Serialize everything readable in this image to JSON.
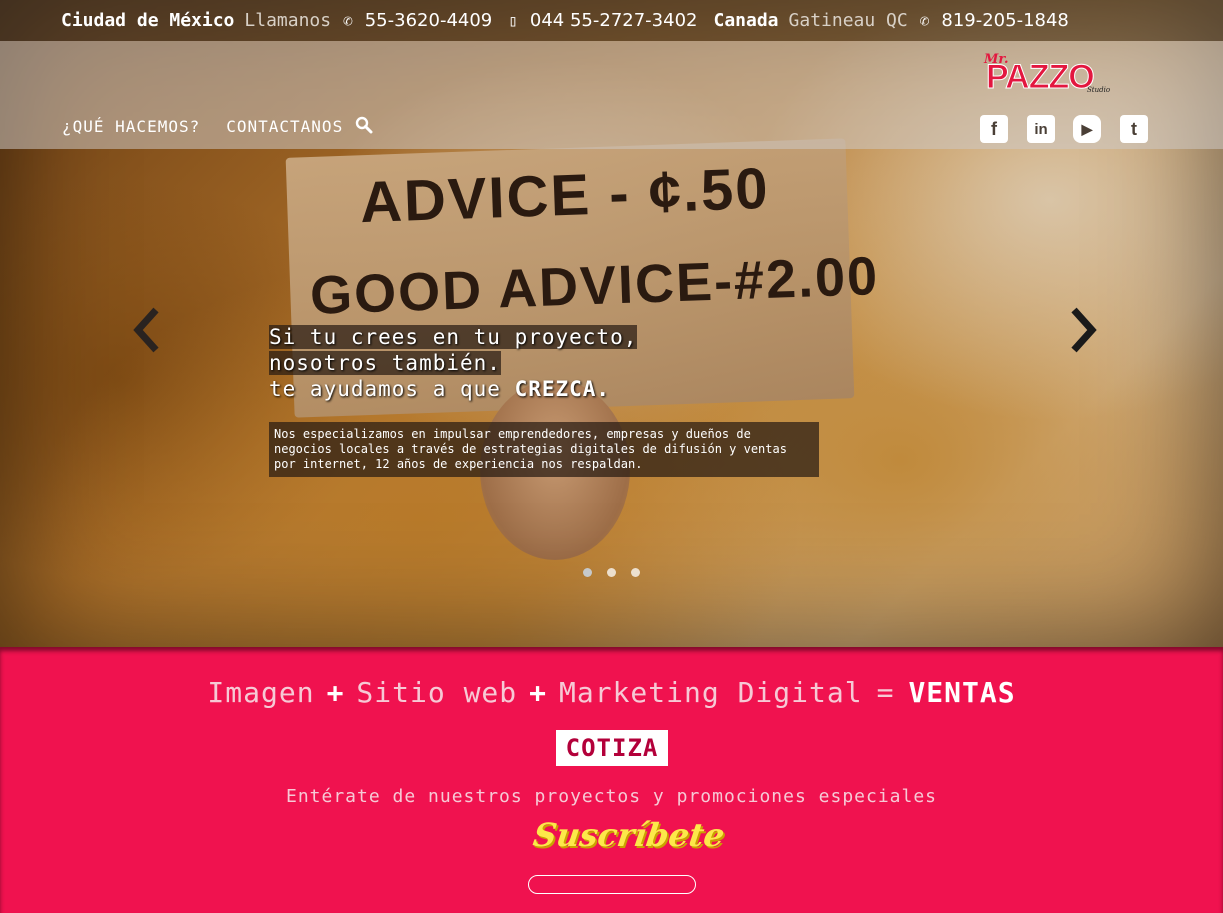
{
  "topbar": {
    "mexico_city": "Ciudad de México",
    "call_label": "Llamanos",
    "phone_1": "55-3620-4409",
    "mobile_1": "044 55-2727-3402",
    "canada_label": "Canada",
    "canada_city": "Gatineau QC",
    "phone_2": "819-205-1848"
  },
  "logo": {
    "mr": "Mr.",
    "name": "PAZZO",
    "studio": "Studio"
  },
  "nav": {
    "items": [
      {
        "label": "¿QUÉ HACEMOS?"
      },
      {
        "label": "CONTACTANOS"
      }
    ],
    "search_icon": "search-icon"
  },
  "social": {
    "icons": [
      "facebook-icon",
      "linkedin-icon",
      "youtube-icon",
      "twitter-icon"
    ],
    "glyphs": [
      "f",
      "in",
      "▶",
      "t"
    ]
  },
  "slider": {
    "headline_line1": "Si tu crees en tu proyecto, nosotros también.",
    "headline_line2_prefix": "te ayudamos a que ",
    "headline_line2_emphasis": "CREZCA.",
    "description": "Nos especializamos en impulsar emprendedores, empresas y dueños de negocios locales a través de estrategias digitales de difusión y ventas por internet, 12 años de experiencia nos respaldan.",
    "slide_count": 3,
    "active_slide": 1,
    "photo_sign_line1": "ADVICE - ¢.50",
    "photo_sign_line2": "GOOD ADVICE-#2.00"
  },
  "promo": {
    "term1": "Imagen",
    "plus": "+",
    "term2": "Sitio web",
    "term3": "Marketing Digital",
    "equals": "=",
    "result": "VENTAS",
    "cta_label": "COTIZA",
    "subtitle": "Entérate de nuestros proyectos y promociones especiales",
    "subscribe_label": "Suscríbete",
    "email_placeholder": ""
  },
  "colors": {
    "accent_pink": "#f0124f",
    "logo_red": "#e3173f",
    "subscribe_yellow": "#fde84a"
  }
}
